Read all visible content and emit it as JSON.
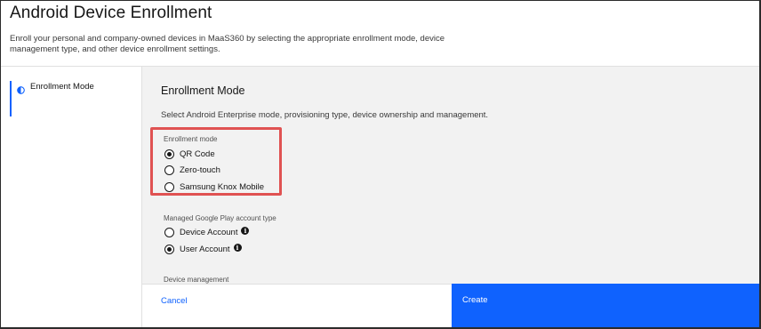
{
  "header": {
    "title": "Android Device Enrollment",
    "description": "Enroll your personal and company-owned devices in MaaS360 by selecting the appropriate enrollment mode, device management type, and other device enrollment settings."
  },
  "sidebar": {
    "items": [
      {
        "label": "Enrollment Mode",
        "icon": "half-circle-icon",
        "active": true
      }
    ]
  },
  "main": {
    "title": "Enrollment Mode",
    "description": "Select Android Enterprise mode, provisioning type, device ownership and management.",
    "enrollment_mode": {
      "label": "Enrollment mode",
      "options": [
        {
          "label": "QR Code",
          "checked": true
        },
        {
          "label": "Zero-touch",
          "checked": false
        },
        {
          "label": "Samsung Knox Mobile",
          "checked": false
        }
      ]
    },
    "account_type": {
      "label": "Managed Google Play account type",
      "options": [
        {
          "label": "Device Account",
          "checked": false,
          "info": "i"
        },
        {
          "label": "User Account",
          "checked": true,
          "info": "i"
        }
      ]
    },
    "device_management": {
      "label": "Device management"
    }
  },
  "footer": {
    "cancel_label": "Cancel",
    "create_label": "Create"
  },
  "colors": {
    "accent": "#0f62fe",
    "panel_bg": "#f2f2f2",
    "highlight": "#e05252"
  }
}
